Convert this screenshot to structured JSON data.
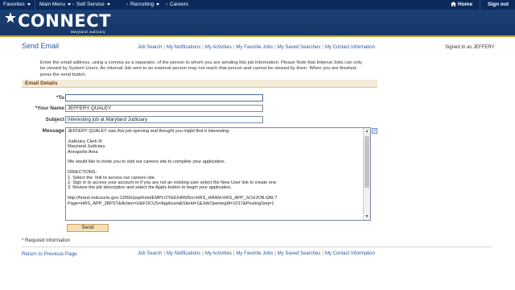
{
  "topnav": {
    "favorites": "Favorites",
    "main_menu": "Main Menu",
    "self_service": "Self Service",
    "recruiting": "Recruiting",
    "careers": "Careers",
    "home": "Home",
    "sign_out": "Sign out"
  },
  "banner": {
    "logo": "CONNECT",
    "sub": "Maryland Judiciary"
  },
  "header": {
    "title": "Send Email",
    "signed_in": "Signed In as JEFFERY"
  },
  "nav_links": [
    "Job Search",
    "My Notifications",
    "My Activities",
    "My Favorite Jobs",
    "My Saved Searches",
    "My Contact Information"
  ],
  "intro": "Enter the email address, using a comma as a separator, of the person to whom you are sending this job information. Please Note that Internal Jobs can only be viewed by System Users. An Internal Job sent to an external person may not reach that person and cannot be viewed by them. When you are finished, press the send button.",
  "section": {
    "title": "Email Details"
  },
  "form": {
    "to_label": "*To",
    "to_value": "",
    "name_label": "*Your Name",
    "name_value": "JEFFERY QUALEY",
    "subject_label": "Subject",
    "subject_value": "Interesting job at Maryland Judiciary",
    "message_label": "Message",
    "message_value": "JEFFERY QUALEY saw this job opening and thought you might find it interesting:\n\nJudiciary Clerk III\nMaryland Judiciary\nAnnapolis Area\n\nWe would like to invite you to visit our careers site to complete your application.\n\nDIRECTIONS:\n1. Select the  link to access our careers site.\n2. Sign in to access your account or if you are not an existing user select the New User link to create one.\n3. Review the job description and select the Apply button to begin your application.\n\nhttp://hrtest.mdcourts.gov:12650/psp/hrtst/EMPLOYEE/HRMS/c/HRS_HRAM.HRS_APP_SCHJOB.GBL?\nPage=HRS_APP_JBPST&Action=U&FOCUS=Applicant&SiteId=1&JobOpeningId=1017&PostingSeq=1",
    "send_label": "Send"
  },
  "required_note": "* Required Information",
  "footer": {
    "return_label": "Return to Previous Page"
  },
  "colors": {
    "nav_bg": "#0b2a5b",
    "banner_bg": "#1c3f73",
    "accent_gold": "#c9a02f",
    "link": "#2a57a0",
    "section_text": "#7a3a10",
    "button_bg": "#f7dfb3"
  }
}
